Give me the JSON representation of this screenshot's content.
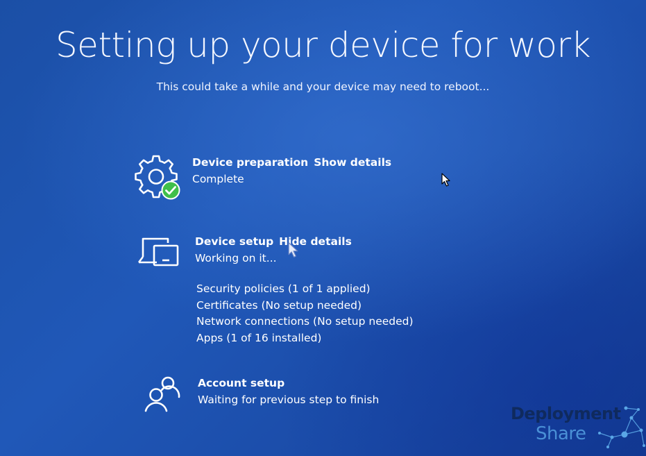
{
  "header": {
    "title": "Setting up your device for work",
    "subtitle": "This could take a while and your device may need to reboot..."
  },
  "steps": [
    {
      "name": "Device preparation",
      "toggle_label": "Show details",
      "status": "Complete",
      "icon": "gear-with-check-icon"
    },
    {
      "name": "Device setup",
      "toggle_label": "Hide details",
      "status": "Working on it...",
      "icon": "devices-icon",
      "details": [
        "Security policies (1 of 1 applied)",
        "Certificates (No setup needed)",
        "Network connections (No setup needed)",
        "Apps (1 of 16 installed)"
      ]
    },
    {
      "name": "Account setup",
      "status": "Waiting for previous step to finish",
      "icon": "people-icon"
    }
  ],
  "watermark": {
    "line1": "Deployment",
    "line2": "Share"
  },
  "colors": {
    "background": "#1b4fa6",
    "text": "#ffffff",
    "check": "#3fbf4a"
  }
}
